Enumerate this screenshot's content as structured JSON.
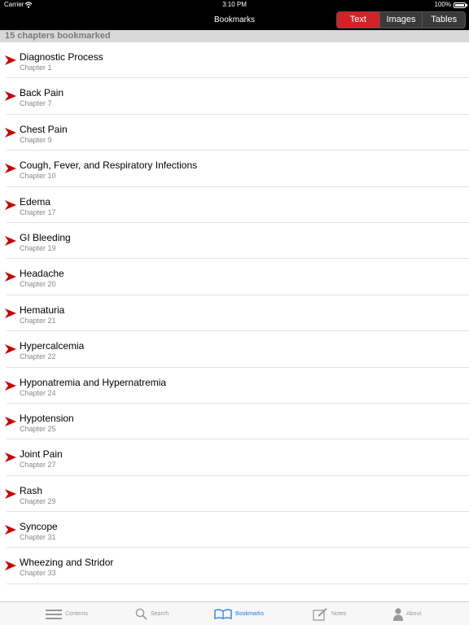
{
  "status_bar": {
    "carrier": "Carrier",
    "time": "3:10 PM",
    "battery": "100%"
  },
  "nav": {
    "title": "Bookmarks",
    "segments": [
      "Text",
      "Images",
      "Tables"
    ],
    "selected_segment": "Text"
  },
  "section_header": "15 chapters bookmarked",
  "bookmarks": [
    {
      "title": "Diagnostic Process",
      "chapter": "Chapter 1"
    },
    {
      "title": "Back Pain",
      "chapter": "Chapter 7"
    },
    {
      "title": "Chest Pain",
      "chapter": "Chapter 9"
    },
    {
      "title": "Cough, Fever, and Respiratory Infections",
      "chapter": "Chapter 10"
    },
    {
      "title": "Edema",
      "chapter": "Chapter 17"
    },
    {
      "title": "GI Bleeding",
      "chapter": "Chapter 19"
    },
    {
      "title": "Headache",
      "chapter": "Chapter 20"
    },
    {
      "title": "Hematuria",
      "chapter": "Chapter 21"
    },
    {
      "title": "Hypercalcemia",
      "chapter": "Chapter 22"
    },
    {
      "title": "Hyponatremia and Hypernatremia",
      "chapter": "Chapter 24"
    },
    {
      "title": "Hypotension",
      "chapter": "Chapter 25"
    },
    {
      "title": "Joint Pain",
      "chapter": "Chapter 27"
    },
    {
      "title": "Rash",
      "chapter": "Chapter 29"
    },
    {
      "title": "Syncope",
      "chapter": "Chapter 31"
    },
    {
      "title": "Wheezing and Stridor",
      "chapter": "Chapter 33"
    }
  ],
  "tab_bar": [
    {
      "label": "Contents",
      "icon": "list-icon",
      "active": false
    },
    {
      "label": "Search",
      "icon": "search-icon",
      "active": false
    },
    {
      "label": "Bookmarks",
      "icon": "open-book-icon",
      "active": true
    },
    {
      "label": "Notes",
      "icon": "note-edit-icon",
      "active": false
    },
    {
      "label": "About",
      "icon": "person-icon",
      "active": false
    }
  ],
  "colors": {
    "accent_red": "#d42128",
    "tab_active_blue": "#1e7be0",
    "arrow_red": "#cc0000"
  }
}
